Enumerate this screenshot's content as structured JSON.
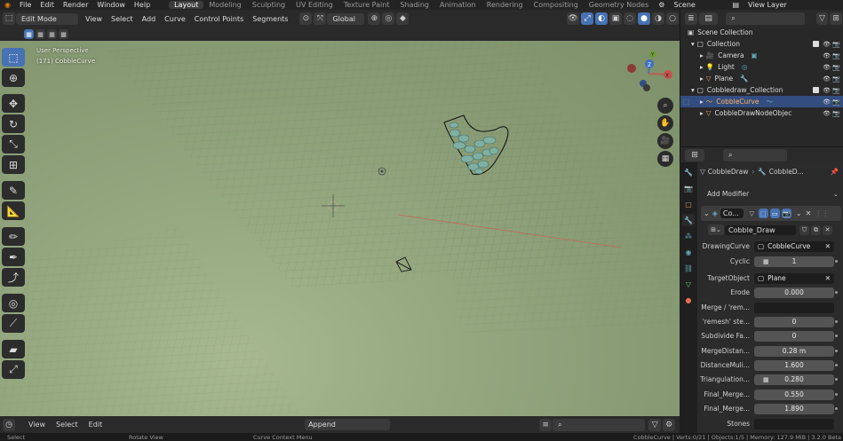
{
  "topbar": {
    "menus": [
      "File",
      "Edit",
      "Render",
      "Window",
      "Help"
    ],
    "workspaces": [
      {
        "label": "Layout",
        "active": true
      },
      {
        "label": "Modeling"
      },
      {
        "label": "Sculpting"
      },
      {
        "label": "UV Editing"
      },
      {
        "label": "Texture Paint"
      },
      {
        "label": "Shading"
      },
      {
        "label": "Animation"
      },
      {
        "label": "Rendering"
      },
      {
        "label": "Compositing"
      },
      {
        "label": "Geometry Nodes"
      }
    ],
    "scene": "Scene",
    "view_layer": "View Layer"
  },
  "header": {
    "mode": "Edit Mode",
    "menus": [
      "View",
      "Select",
      "Add",
      "Curve",
      "Control Points",
      "Segments"
    ],
    "orientation": "Global"
  },
  "viewport": {
    "line1": "User Perspective",
    "line2": "(171) CobbleCurve",
    "gizmo": {
      "y": "Y",
      "x": "X",
      "z": "Z"
    }
  },
  "bottom": {
    "menus": [
      "View",
      "Select",
      "Edit"
    ],
    "keying": "Append"
  },
  "status": {
    "select": "Select",
    "rotate": "Rotate View",
    "context": "Curve Context Menu",
    "info": "CobbleCurve | Verts:0/21 | Objects:1/5 | Memory: 127.9 MiB | 3.2.0 Beta"
  },
  "outliner": {
    "title": "Scene Collection",
    "rows": [
      {
        "label": "Collection",
        "indent": 1,
        "icon": "collection",
        "check": true
      },
      {
        "label": "Camera",
        "indent": 2,
        "icon": "camera"
      },
      {
        "label": "Light",
        "indent": 2,
        "icon": "light"
      },
      {
        "label": "Plane",
        "indent": 2,
        "icon": "mesh"
      },
      {
        "label": "Cobbledraw_Collection",
        "indent": 1,
        "icon": "collection",
        "check": true
      },
      {
        "label": "CobbleCurve",
        "indent": 2,
        "icon": "curve",
        "selected": true
      },
      {
        "label": "CobbleDrawNodeObjec",
        "indent": 2,
        "icon": "mesh"
      }
    ]
  },
  "properties": {
    "breadcrumb_obj": "CobbleDraw",
    "breadcrumb_mod": "CobbleD...",
    "add_modifier": "Add Modifier",
    "mod_short": "Co...",
    "node_group": "Cobble_Draw",
    "fields": [
      {
        "label": "DrawingCurve",
        "value": "CobbleCurve",
        "kind": "obj"
      },
      {
        "label": "Cyclic",
        "value": "1",
        "kind": "num"
      },
      {
        "label": "TargetObject",
        "value": "Plane",
        "kind": "obj"
      },
      {
        "label": "Erode",
        "value": "0.000",
        "kind": "num"
      },
      {
        "label": "Merge / 'rem...",
        "value": "",
        "kind": "dark"
      },
      {
        "label": "'remesh' ste...",
        "value": "0",
        "kind": "num"
      },
      {
        "label": "Subdivide Fa...",
        "value": "0",
        "kind": "num"
      },
      {
        "label": "MergeDistan...",
        "value": "0.28 m",
        "kind": "num"
      },
      {
        "label": "DistanceMuli...",
        "value": "1.600",
        "kind": "num"
      },
      {
        "label": "Triangulation...",
        "value": "0.280",
        "kind": "num"
      },
      {
        "label": "Final_Merge...",
        "value": "0.550",
        "kind": "num"
      },
      {
        "label": "Final_Merge...",
        "value": "1.890",
        "kind": "num"
      },
      {
        "label": "Stones",
        "value": "",
        "kind": "dark"
      }
    ]
  },
  "colors": {
    "accent": "#4772b3",
    "viewport": "#889b74",
    "selected_row": "#334d80"
  }
}
